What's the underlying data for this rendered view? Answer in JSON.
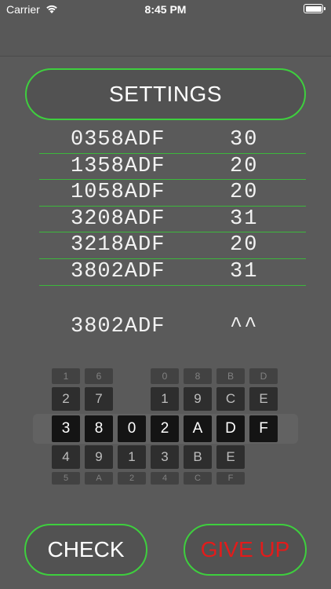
{
  "status_bar": {
    "carrier": "Carrier",
    "time": "8:45 PM"
  },
  "settings_button": {
    "label": "SETTINGS"
  },
  "history": [
    {
      "code": "0358ADF",
      "score": "30"
    },
    {
      "code": "1358ADF",
      "score": "20"
    },
    {
      "code": "1058ADF",
      "score": "20"
    },
    {
      "code": "3208ADF",
      "score": "31"
    },
    {
      "code": "3218ADF",
      "score": "20"
    },
    {
      "code": "3802ADF",
      "score": "31"
    }
  ],
  "current_guess": {
    "code": "3802ADF",
    "marker": "^^"
  },
  "picker": {
    "wheels": [
      {
        "rows": [
          "1",
          "2",
          "3",
          "4",
          "5"
        ]
      },
      {
        "rows": [
          "6",
          "7",
          "8",
          "9",
          "A"
        ]
      },
      {
        "rows": [
          "",
          "",
          "0",
          "1",
          "2"
        ]
      },
      {
        "rows": [
          "0",
          "1",
          "2",
          "3",
          "4"
        ]
      },
      {
        "rows": [
          "8",
          "9",
          "A",
          "B",
          "C"
        ]
      },
      {
        "rows": [
          "B",
          "C",
          "D",
          "E",
          "F"
        ]
      },
      {
        "rows": [
          "D",
          "E",
          "F",
          "",
          ""
        ]
      }
    ]
  },
  "check_button": {
    "label": "CHECK"
  },
  "give_up_button": {
    "label": "GIVE UP"
  },
  "colors": {
    "accent_green": "#3ecf3e",
    "give_up_red": "#e31b1b",
    "background": "#5a5a5a"
  }
}
